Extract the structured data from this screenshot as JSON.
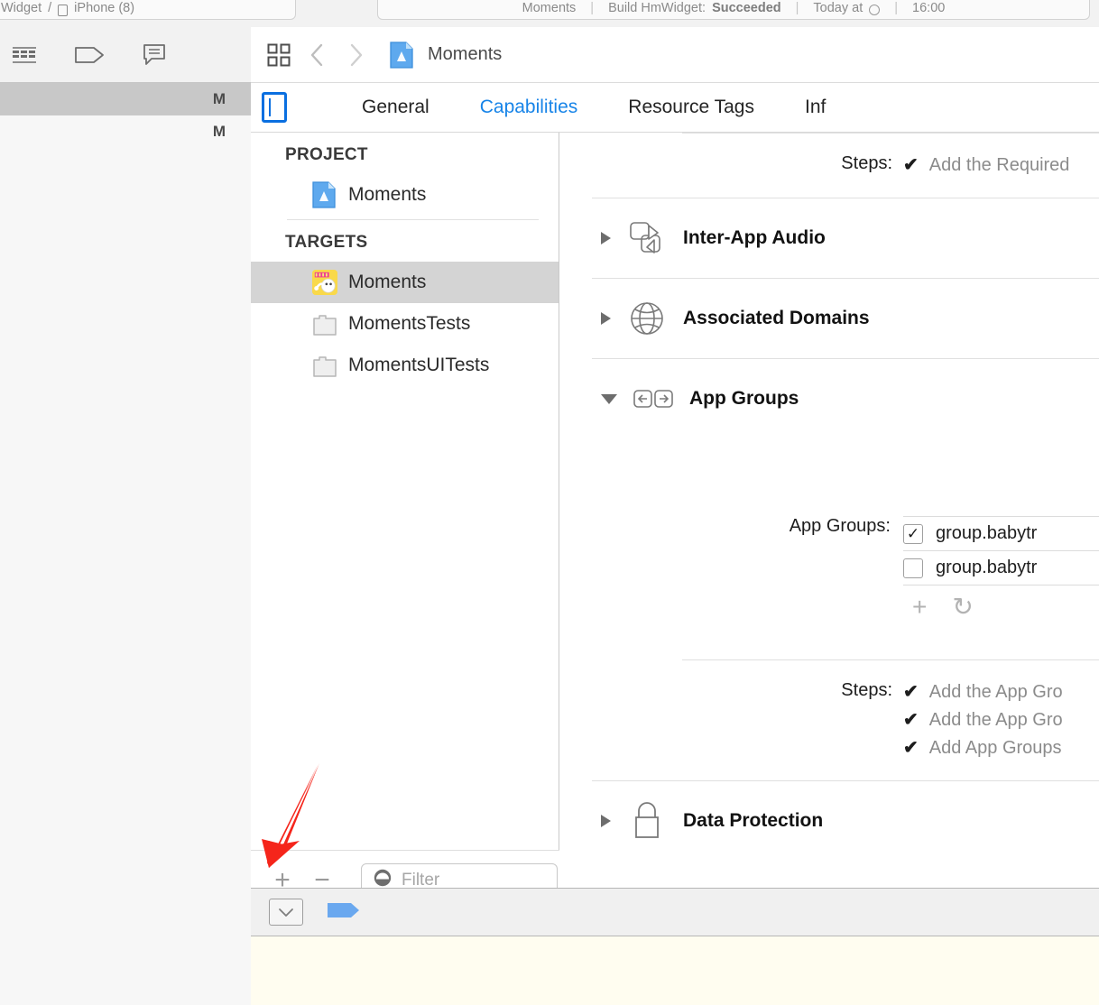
{
  "toolbar": {
    "scheme": {
      "target": "Widget",
      "separator": "/",
      "destination": "iPhone (8)",
      "device_icon": "device-icon"
    },
    "status": {
      "project": "Moments",
      "sep1": "|",
      "action": "Build HmWidget:",
      "result": "Succeeded",
      "sep2": "|",
      "when": "Today at",
      "clock_icon": "clock-icon",
      "sep3": "|",
      "time": "16:00"
    }
  },
  "navigator": {
    "filter_icons": [
      {
        "name": "table-view-icon",
        "label": "Table"
      },
      {
        "name": "tag-icon",
        "label": "Tag"
      },
      {
        "name": "comment-icon",
        "label": "Comment"
      }
    ],
    "rows": [
      {
        "badge": "M",
        "selected": true
      },
      {
        "badge": "M",
        "selected": false
      }
    ]
  },
  "jumpbar": {
    "grid_icon": "related-items-icon",
    "back_icon": "chevron-left-icon",
    "forward_icon": "chevron-right-icon",
    "project_icon": "xcode-project-icon",
    "title": "Moments"
  },
  "tabbar": {
    "toggle_icon": "navigator-toggle-icon",
    "tabs": [
      {
        "label": "General",
        "active": false
      },
      {
        "label": "Capabilities",
        "active": true
      },
      {
        "label": "Resource Tags",
        "active": false
      },
      {
        "label": "Inf",
        "active": false
      }
    ]
  },
  "project_pane": {
    "project_header": "PROJECT",
    "project_items": [
      {
        "label": "Moments",
        "icon": "xcode-project-icon",
        "selected": false
      }
    ],
    "targets_header": "TARGETS",
    "target_items": [
      {
        "label": "Moments",
        "icon": "app-icon-moments",
        "selected": true
      },
      {
        "label": "MomentsTests",
        "icon": "test-bundle-icon",
        "selected": false
      },
      {
        "label": "MomentsUITests",
        "icon": "test-bundle-icon",
        "selected": false
      }
    ],
    "add_button": "+",
    "remove_button": "−",
    "filter_placeholder": "Filter",
    "filter_value": "",
    "filter_icon": "filter-icon"
  },
  "capabilities": {
    "top_steps": {
      "label": "Steps:",
      "items": [
        {
          "check": "✔",
          "text": "Add the Required"
        }
      ]
    },
    "sections": [
      {
        "name": "Inter-App Audio",
        "icon": "inter-app-audio-icon",
        "expanded": false,
        "disclosure": "▶"
      },
      {
        "name": "Associated Domains",
        "icon": "globe-icon",
        "expanded": false,
        "disclosure": "▶"
      },
      {
        "name": "App Groups",
        "icon": "app-groups-icon",
        "expanded": true,
        "disclosure": "▼"
      },
      {
        "name": "Data Protection",
        "icon": "lock-icon",
        "expanded": false,
        "disclosure": "▶"
      }
    ],
    "app_groups": {
      "field_label": "App Groups:",
      "entries": [
        {
          "checked": true,
          "check_glyph": "✓",
          "name": "group.babytr"
        },
        {
          "checked": false,
          "check_glyph": "",
          "name": "group.babytr"
        }
      ],
      "add_icon": "+",
      "refresh_icon": "↻"
    },
    "app_groups_steps": {
      "label": "Steps:",
      "items": [
        {
          "check": "✔",
          "text": "Add the App Gro"
        },
        {
          "check": "✔",
          "text": "Add the App Gro"
        },
        {
          "check": "✔",
          "text": "Add App Groups"
        }
      ]
    }
  },
  "debugbar": {
    "buttons": [
      {
        "name": "hide-debug-area-icon",
        "glyph": "▽"
      },
      {
        "name": "breakpoint-tag-icon",
        "glyph": ""
      }
    ]
  },
  "annotation": {
    "arrow": "red-arrow-pointing-to-add-button",
    "color": "#F5251B"
  },
  "colors": {
    "accent_blue": "#1784e8",
    "toggle_blue": "#0a6fe0",
    "breakpoint_blue": "#6aa8ef",
    "console_bg": "#FFFDF0",
    "selection_gray": "#d4d4d4",
    "annotation_red": "#F5251B"
  }
}
